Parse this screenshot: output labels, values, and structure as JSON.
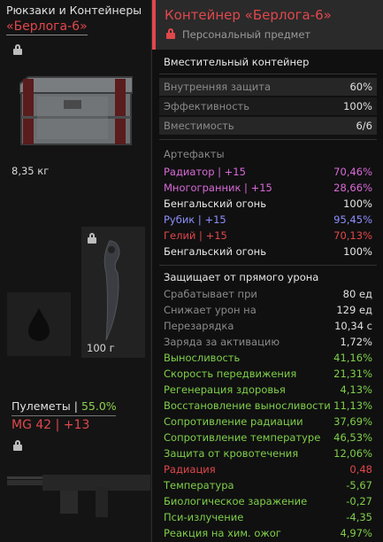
{
  "inventory": {
    "category_title": "Рюкзаки и Контейнеры",
    "item_name": "«Берлога-6»",
    "item_weight": "8,35 кг",
    "knife_weight": "100 г",
    "mg_category": "Пулеметы",
    "mg_separator": "|",
    "mg_pct": "55.0%",
    "mg_name": "MG 42 | +13"
  },
  "tooltip": {
    "title": "Контейнер «Берлога-6»",
    "subtitle": "Персональный предмет",
    "description": "Вместительный контейнер",
    "stats": [
      {
        "label": "Внутренняя защита",
        "value": "60%"
      },
      {
        "label": "Эффективность",
        "value": "100%"
      },
      {
        "label": "Вместимость",
        "value": "6/6"
      }
    ],
    "artifacts_label": "Артефакты",
    "artifacts": [
      {
        "name": "Радиатор | +15",
        "value": "70,46%",
        "color": "#d86ad8"
      },
      {
        "name": "Многогранник | +15",
        "value": "28,66%",
        "color": "#d86ad8"
      },
      {
        "name": "Бенгальский огонь",
        "value": "100%",
        "color": "#e8e8e8"
      },
      {
        "name": "Рубик | +15",
        "value": "95,45%",
        "color": "#8f8fff"
      },
      {
        "name": "Гелий | +15",
        "value": "70,13%",
        "color": "#e0474c"
      },
      {
        "name": "Бенгальский огонь",
        "value": "100%",
        "color": "#e8e8e8"
      }
    ],
    "protection_label": "Защищает от прямого урона",
    "protection": [
      {
        "label": "Срабатывает при",
        "value": "80 ед",
        "color": "#8a8a8a",
        "vcolor": "#e0e0e0"
      },
      {
        "label": "Снижает урон на",
        "value": "129 ед",
        "color": "#8a8a8a",
        "vcolor": "#e0e0e0"
      },
      {
        "label": "Перезарядка",
        "value": "10,34 с",
        "color": "#8a8a8a",
        "vcolor": "#e0e0e0"
      },
      {
        "label": "Заряда за активацию",
        "value": "1,72%",
        "color": "#8a8a8a",
        "vcolor": "#e0e0e0"
      }
    ],
    "effects": [
      {
        "label": "Выносливость",
        "value": "41,16%",
        "color": "#7fcf4a"
      },
      {
        "label": "Скорость передвижения",
        "value": "21,31%",
        "color": "#7fcf4a"
      },
      {
        "label": "Регенерация здоровья",
        "value": "4,13%",
        "color": "#7fcf4a"
      },
      {
        "label": "Восстановление выносливости",
        "value": "11,13%",
        "color": "#7fcf4a"
      },
      {
        "label": "Сопротивление радиации",
        "value": "37,69%",
        "color": "#7fcf4a"
      },
      {
        "label": "Сопротивление температуре",
        "value": "46,53%",
        "color": "#7fcf4a"
      },
      {
        "label": "Защита от кровотечения",
        "value": "12,06%",
        "color": "#7fcf4a"
      },
      {
        "label": "Радиация",
        "value": "0,48",
        "color": "#e0474c"
      },
      {
        "label": "Температура",
        "value": "-5,67",
        "color": "#7fcf4a"
      },
      {
        "label": "Биологическое заражение",
        "value": "-0,27",
        "color": "#7fcf4a"
      },
      {
        "label": "Пси-излучение",
        "value": "-4,35",
        "color": "#7fcf4a"
      },
      {
        "label": "Реакция на хим. ожог",
        "value": "4,97%",
        "color": "#7fcf4a"
      }
    ]
  }
}
